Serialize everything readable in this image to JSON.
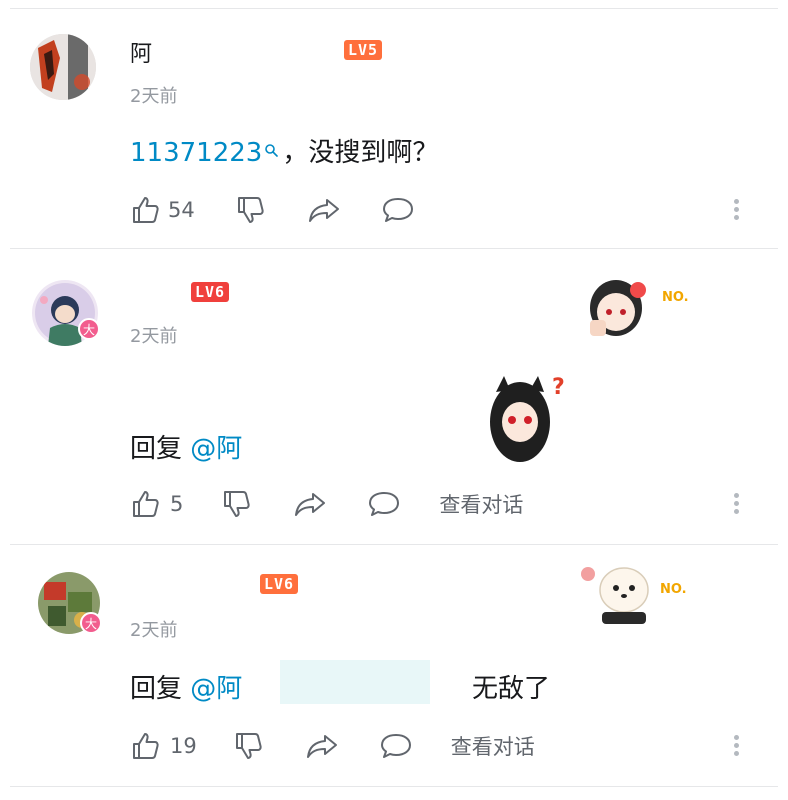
{
  "comments": [
    {
      "username": "阿",
      "level": "LV5",
      "time": "2天前",
      "content_link": "11371223",
      "content_text": "，没搜到啊？",
      "likes": "54",
      "has_view_conversation": false
    },
    {
      "username": "",
      "level": "LV6",
      "time": "2天前",
      "reply_prefix": "回复",
      "mention": "@阿",
      "content_text": "",
      "likes": "5",
      "view_conversation": "查看对话"
    },
    {
      "username": "",
      "level": "LV6",
      "time": "2天前",
      "reply_prefix": "回复",
      "mention": "@阿",
      "content_text": "无敌了",
      "likes": "19",
      "view_conversation": "查看对话"
    }
  ],
  "badges": {
    "da": "大",
    "no": "NO."
  },
  "colors": {
    "link": "#008ac5",
    "level_orange": "#ff6f3c",
    "vip_pink": "#f25d8e"
  }
}
